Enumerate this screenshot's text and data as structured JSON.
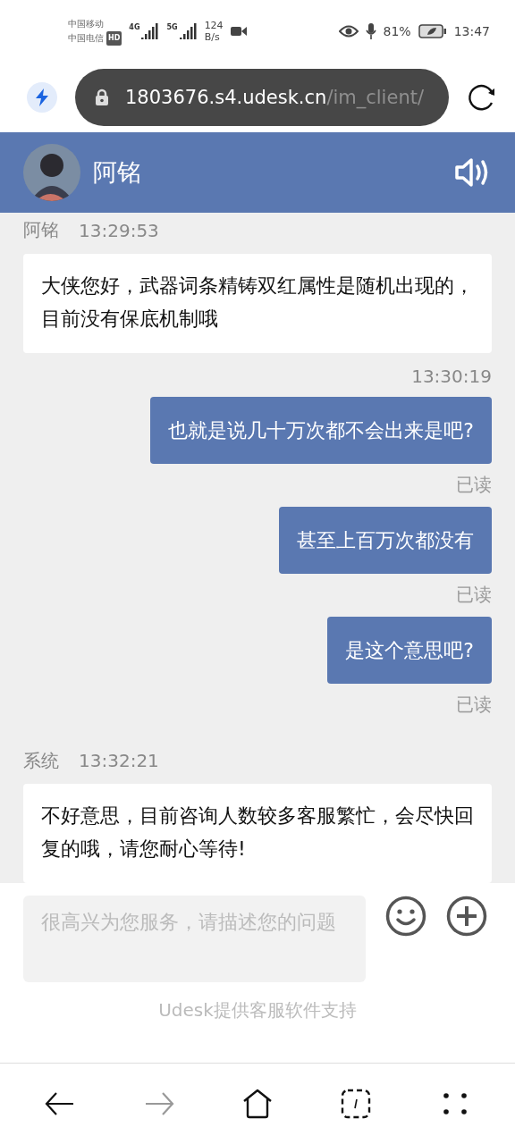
{
  "status_bar": {
    "carrier_1": "中国移动",
    "carrier_2": "中国电信",
    "hd": "HD",
    "network_1": "4G",
    "network_2": "5G",
    "speed_value": "124",
    "speed_unit": "B/s",
    "battery": "81%",
    "time": "13:47"
  },
  "address_bar": {
    "host": "1803676.s4.udesk.cn",
    "path": "/im_client/"
  },
  "header": {
    "title": "阿铭"
  },
  "messages": [
    {
      "kind": "agent",
      "sender": "阿铭",
      "time": "13:29:53",
      "text": "大侠您好，武器词条精铸双红属性是随机出现的，目前没有保底机制哦"
    },
    {
      "kind": "customer",
      "time": "13:30:19",
      "text": "也就是说几十万次都不会出来是吧?",
      "status": "已读"
    },
    {
      "kind": "customer",
      "text": "甚至上百万次都没有",
      "status": "已读"
    },
    {
      "kind": "customer",
      "text": "是这个意思吧?",
      "status": "已读"
    },
    {
      "kind": "agent",
      "sender": "系统",
      "time": "13:32:21",
      "text": "不好意思，目前咨询人数较多客服繁忙，会尽快回复的哦，请您耐心等待!"
    }
  ],
  "composer": {
    "placeholder": "很高兴为您服务，请描述您的问题"
  },
  "footer": "Udesk提供客服软件支持"
}
